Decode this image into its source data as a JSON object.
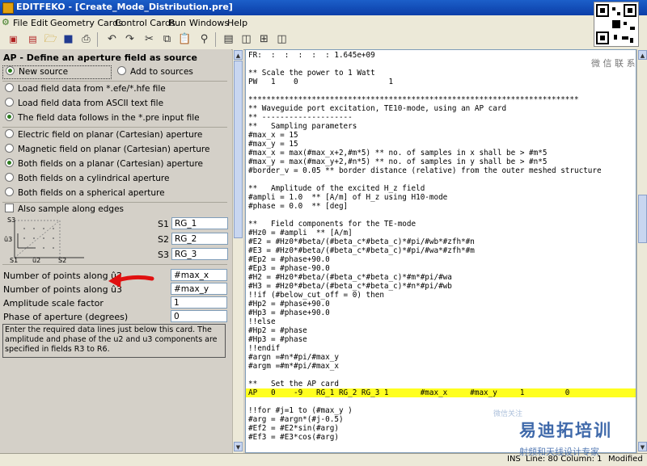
{
  "window": {
    "title": "EDITFEKO - [Create_Mode_Distribution.pre]"
  },
  "menu": [
    "File",
    "Edit",
    "Geometry Cards",
    "Control Cards",
    "Run",
    "Windows",
    "Help"
  ],
  "toolbar_icons": [
    "new-pre-icon",
    "new-file-icon",
    "open-icon",
    "save-icon",
    "print-icon",
    "undo-icon",
    "redo-icon",
    "cut-icon",
    "copy-icon",
    "paste-icon",
    "find-icon",
    "layout-horizontal-icon",
    "layout-vertical-icon",
    "layout-grid-icon"
  ],
  "card": {
    "title": "AP - Define an aperture field as source",
    "source_new": "New source",
    "source_add": "Add to sources",
    "load_options": [
      "Load field data from *.efe/*.hfe file",
      "Load field data from ASCII text file",
      "The field data follows in the *.pre input file"
    ],
    "field_options": [
      "Electric field on planar (Cartesian) aperture",
      "Magnetic field on planar (Cartesian) aperture",
      "Both fields on a planar (Cartesian) aperture",
      "Both fields on a cylindrical aperture",
      "Both fields on a spherical aperture"
    ],
    "sample_edges": "Also sample along edges",
    "diagram_labels": {
      "s3": "S3",
      "u3": "û3",
      "s1": "S1",
      "u2": "û2",
      "s2": "S2"
    },
    "s_labels": [
      "S1",
      "S2",
      "S3"
    ],
    "s_values": [
      "RG_1",
      "RG_2",
      "RG_3"
    ],
    "params": [
      {
        "label": "Number of points along  û2",
        "value": "#max_x"
      },
      {
        "label": "Number of points along  û3",
        "value": "#max_y"
      },
      {
        "label": "Amplitude scale factor",
        "value": "1"
      },
      {
        "label": "Phase of aperture (degrees)",
        "value": "0"
      }
    ],
    "help": "Enter the required data lines just below this card. The amplitude and phase of the u2 and u3 components are specified in fields R3 to R6."
  },
  "code_lines": [
    "FR:  :  :  :  :  : 1.645e+09",
    "",
    "** Scale the power to 1 Watt",
    "PW   1    0                    1",
    "",
    "*************************************************************************",
    "** Waveguide port excitation, TE10-mode, using an AP card",
    "** --------------------",
    "**   Sampling parameters",
    "#max_x = 15",
    "#max_y = 15",
    "#max_x = max(#max_x+2,#m*5) ** no. of samples in x shall be > #m*5",
    "#max_y = max(#max_y+2,#n*5) ** no. of samples in y shall be > #n*5",
    "#border_v = 0.05 ** border distance (relative) from the outer meshed structure",
    "",
    "**   Amplitude of the excited H_z field",
    "#ampli = 1.0  ** [A/m] of H_z using H10-mode",
    "#phase = 0.0  ** [deg]",
    "",
    "**   Field components for the TE-mode",
    "#Hz0 = #ampli  ** [A/m]",
    "#E2 = #Hz0*#beta/(#beta_c*#beta_c)*#pi/#wb*#zfh*#n",
    "#E3 = #Hz0*#beta/(#beta_c*#beta_c)*#pi/#wa*#zfh*#m",
    "#Ep2 = #phase+90.0",
    "#Ep3 = #phase-90.0",
    "#H2 = #Hz0*#beta/(#beta_c*#beta_c)*#m*#pi/#wa",
    "#H3 = #Hz0*#beta/(#beta_c*#beta_c)*#n*#pi/#wb",
    "!!if (#below_cut_off = 0) then",
    "#Hp2 = #phase+90.0",
    "#Hp3 = #phase+90.0",
    "!!else",
    "#Hp2 = #phase",
    "#Hp3 = #phase",
    "!!endif",
    "#argn =#n*#pi/#max_y",
    "#argm =#m*#pi/#max_x",
    "",
    "**   Set the AP card",
    "AP   0    -9   RG_1 RG_2 RG_3 1       #max_x     #max_y     1         0",
    "",
    "!!for #j=1 to (#max_y )",
    "#arg = #argn*(#j-0.5)",
    "#Ef2 = #E2*sin(#arg)",
    "#Ef3 = #E3*cos(#arg)"
  ],
  "highlight_line": 38,
  "status": {
    "mode": "INS",
    "position": "Line: 80 Column: 1",
    "state": "Modified"
  },
  "watermark": {
    "qr_caption": "微 信 联 系",
    "brand": "易迪拓培训",
    "tagline": "射频和天线设计专家",
    "small": "微信关注"
  },
  "accent_colors": {
    "titlebar": "#1c5fc9",
    "highlight": "#ffff20",
    "arrow": "#e01010",
    "radio_on": "#2e7d1f"
  }
}
